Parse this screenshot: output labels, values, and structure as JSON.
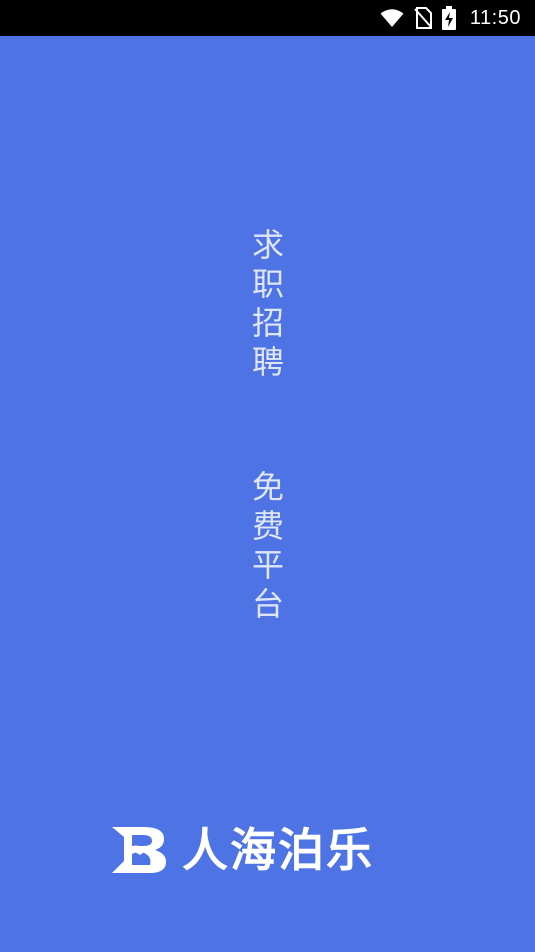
{
  "status_bar": {
    "time": "11:50",
    "icons": [
      "wifi-icon",
      "no-sim-icon",
      "battery-charging-icon"
    ]
  },
  "splash": {
    "tagline_line_1": "求职招聘",
    "tagline_line_2": "免费平台",
    "brand_name": "人海泊乐",
    "brand_logo": "horse-head-r-logo"
  },
  "colors": {
    "background": "#4e73e5",
    "tagline_text": "#dfe6f8",
    "brand_text": "#ffffff",
    "status_bar": "#000000"
  }
}
